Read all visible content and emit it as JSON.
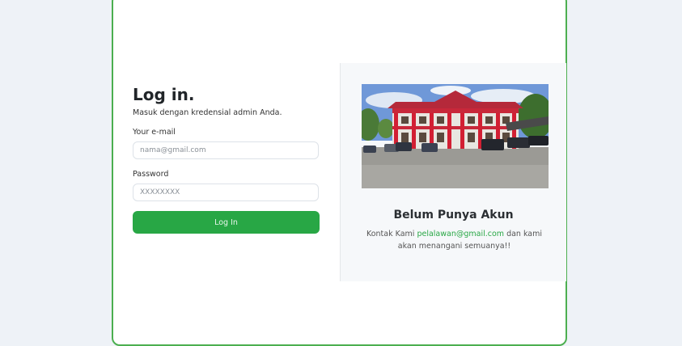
{
  "login": {
    "title": "Log in.",
    "subtitle": "Masuk dengan kredensial admin Anda.",
    "email_label": "Your e-mail",
    "email_placeholder": "nama@gmail.com",
    "password_label": "Password",
    "password_placeholder": "XXXXXXXX",
    "button_label": "Log In"
  },
  "info": {
    "title": "Belum Punya Akun",
    "text_before": "Kontak Kami ",
    "email": "pelalawan@gmail.com",
    "text_after": " dan kami akan menangani semuanya!!"
  },
  "colors": {
    "accent": "#28a745",
    "card_border": "#4caf50",
    "page_bg": "#eef2f7"
  }
}
